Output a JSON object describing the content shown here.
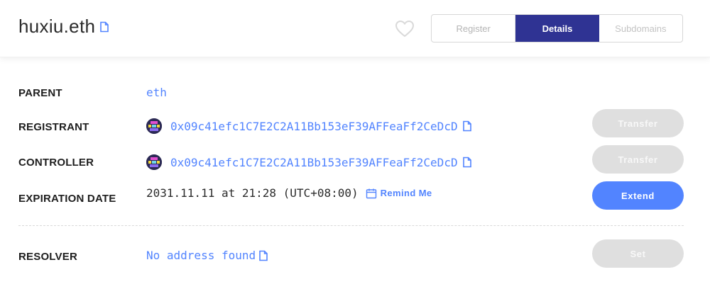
{
  "header": {
    "domain_name": "huxiu.eth",
    "tabs": [
      {
        "label": "Register",
        "active": false
      },
      {
        "label": "Details",
        "active": true
      },
      {
        "label": "Subdomains",
        "active": false
      }
    ]
  },
  "details": {
    "parent_label": "PARENT",
    "parent_value": "eth",
    "registrant_label": "REGISTRANT",
    "registrant_address": "0x09c41efc1C7E2C2A11Bb153eF39AFFeaFf2CeDcD",
    "registrant_button": "Transfer",
    "controller_label": "CONTROLLER",
    "controller_address": "0x09c41efc1C7E2C2A11Bb153eF39AFFeaFf2CeDcD",
    "controller_button": "Transfer",
    "expiration_label": "EXPIRATION DATE",
    "expiration_value": "2031.11.11 at 21:28 (UTC+08:00)",
    "remind_label": "Remind Me",
    "extend_button": "Extend",
    "resolver_label": "RESOLVER",
    "resolver_value": "No address found",
    "resolver_button": "Set"
  },
  "colors": {
    "accent": "#5284ff",
    "tab_active": "#2f3393",
    "disabled_button": "#dfdfdf"
  },
  "icons": [
    "copy-icon",
    "heart-icon",
    "calendar-icon",
    "avatar"
  ]
}
